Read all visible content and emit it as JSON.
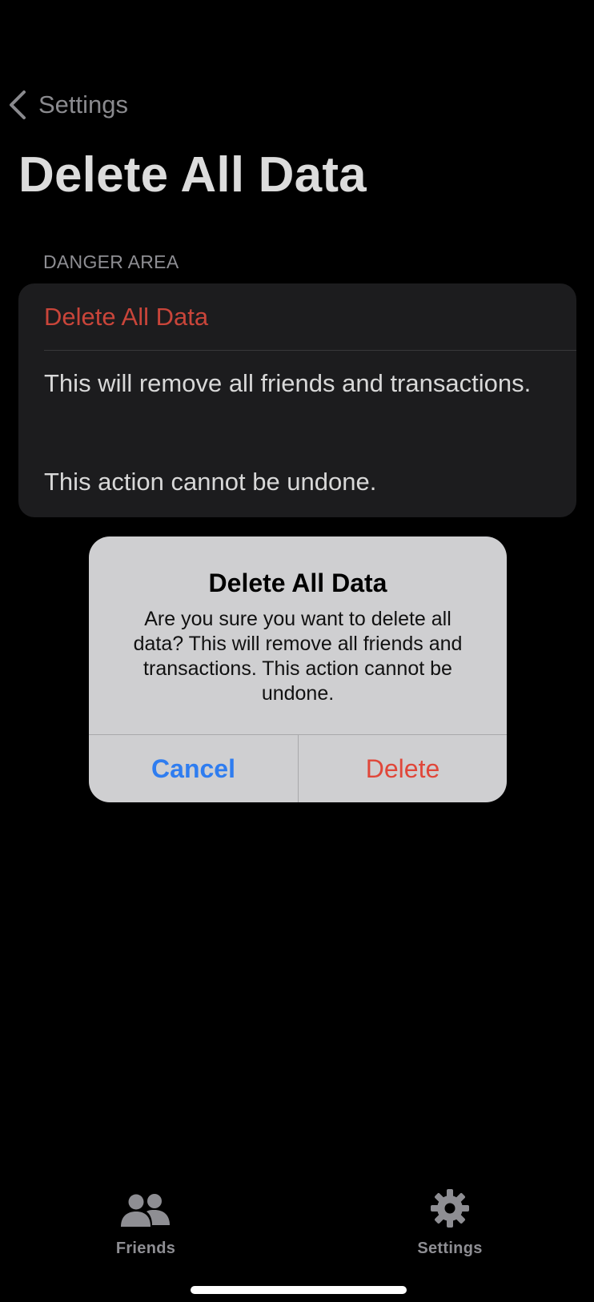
{
  "nav": {
    "back_label": "Settings"
  },
  "page": {
    "title": "Delete All Data"
  },
  "section": {
    "header": "DANGER AREA",
    "delete_row_label": "Delete All Data",
    "description_line1": "This will remove all friends and transactions.",
    "description_line2": "This action cannot be undone."
  },
  "alert": {
    "title": "Delete All Data",
    "message": "Are you sure you want to delete all data? This will remove all friends and transactions. This action cannot be undone.",
    "cancel_label": "Cancel",
    "delete_label": "Delete"
  },
  "tabbar": {
    "items": [
      {
        "label": "Friends",
        "icon": "people-icon"
      },
      {
        "label": "Settings",
        "icon": "gear-icon"
      }
    ]
  },
  "colors": {
    "destructive": "#e0473a",
    "accent": "#2f7df0",
    "background": "#000000",
    "card": "#1c1c1e",
    "alert_background": "#cfcfd1"
  }
}
